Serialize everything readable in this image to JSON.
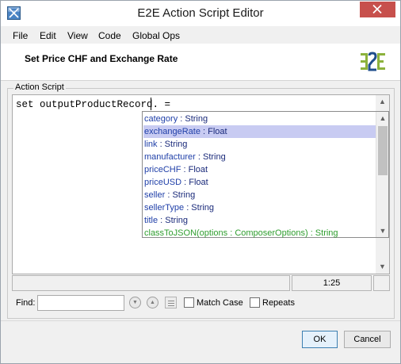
{
  "window": {
    "title": "E2E Action Script Editor"
  },
  "menu": {
    "items": [
      "File",
      "Edit",
      "View",
      "Code",
      "Global Ops"
    ]
  },
  "header": {
    "title": "Set Price CHF and Exchange Rate"
  },
  "editor": {
    "group_label": "Action Script",
    "code_line": "set outputProductRecord. ="
  },
  "autocomplete": {
    "items": [
      {
        "name": "category",
        "type": " : String",
        "kind": "property",
        "selected": false
      },
      {
        "name": "exchangeRate",
        "type": " : Float",
        "kind": "property",
        "selected": true
      },
      {
        "name": "link",
        "type": " : String",
        "kind": "property",
        "selected": false
      },
      {
        "name": "manufacturer",
        "type": " : String",
        "kind": "property",
        "selected": false
      },
      {
        "name": "priceCHF",
        "type": " : Float",
        "kind": "property",
        "selected": false
      },
      {
        "name": "priceUSD",
        "type": " : Float",
        "kind": "property",
        "selected": false
      },
      {
        "name": "seller",
        "type": " : String",
        "kind": "property",
        "selected": false
      },
      {
        "name": "sellerType",
        "type": " : String",
        "kind": "property",
        "selected": false
      },
      {
        "name": "title",
        "type": " : String",
        "kind": "property",
        "selected": false
      },
      {
        "name": "classToJSON(options : ComposerOptions)",
        "type": " : String",
        "kind": "method",
        "selected": false
      }
    ]
  },
  "status": {
    "cursor_position": "1:25"
  },
  "find": {
    "label": "Find:",
    "value": "",
    "match_case_label": "Match Case",
    "match_case_checked": false,
    "repeats_label": "Repeats",
    "repeats_checked": false
  },
  "buttons": {
    "ok": "OK",
    "cancel": "Cancel"
  },
  "colors": {
    "selection": "#c8cbf2",
    "property_text": "#1f3fa8",
    "method_text": "#2f9e2f",
    "close_button": "#c7504c",
    "logo_green": "#8cb23c",
    "logo_blue": "#1f4e8c"
  },
  "icons": {
    "app": "app-icon",
    "close": "close-icon",
    "logo": "e2e-logo-icon",
    "find_next": "find-down-icon",
    "find_prev": "find-up-icon",
    "find_all": "find-list-icon"
  }
}
